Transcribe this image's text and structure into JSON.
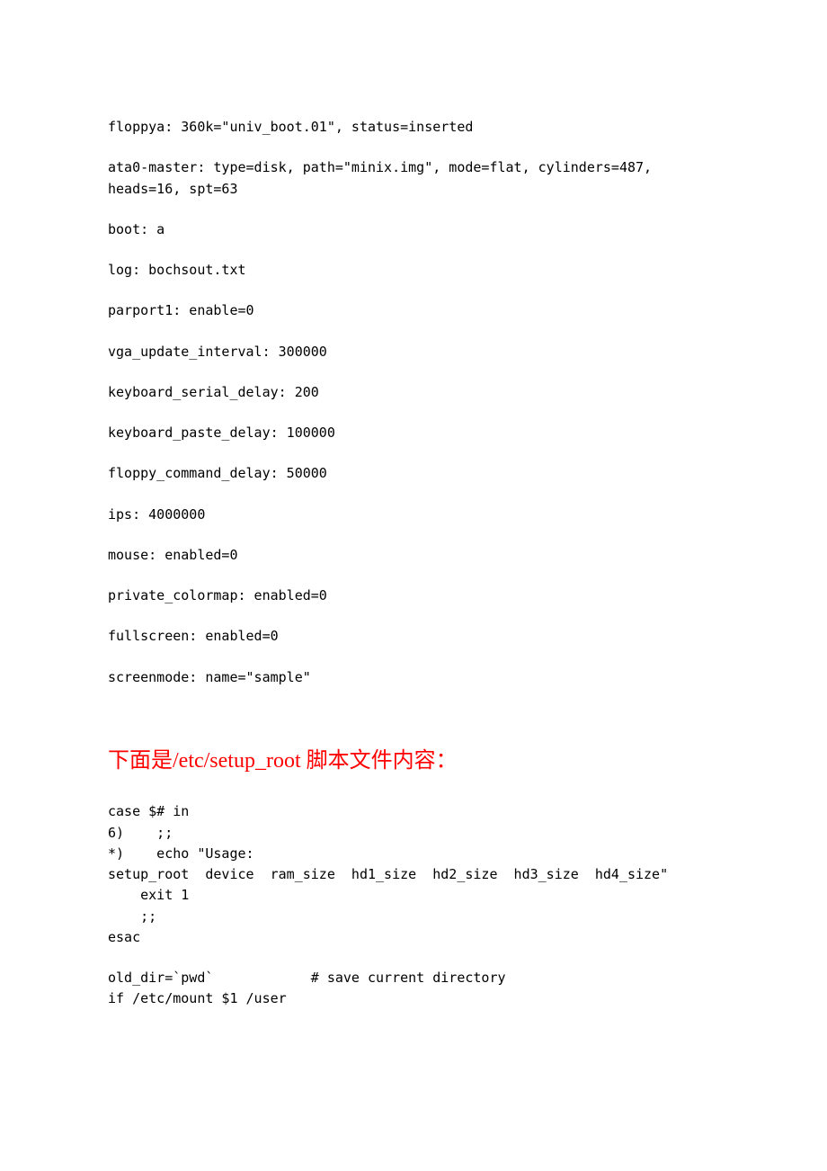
{
  "config_lines": [
    "floppya: 360k=\"univ_boot.01\", status=inserted",
    "ata0-master: type=disk, path=\"minix.img\", mode=flat, cylinders=487, heads=16, spt=63",
    "boot: a",
    "log: bochsout.txt",
    "parport1: enable=0",
    "vga_update_interval: 300000",
    "keyboard_serial_delay: 200",
    "keyboard_paste_delay: 100000",
    "floppy_command_delay: 50000",
    "ips: 4000000",
    "mouse: enabled=0",
    "private_colormap: enabled=0",
    "fullscreen: enabled=0",
    "screenmode: name=\"sample\""
  ],
  "heading": "下面是/etc/setup_root 脚本文件内容：",
  "script_block1": [
    "case $# in",
    "6)    ;;",
    "*)    echo \"Usage:",
    "setup_root  device  ram_size  hd1_size  hd2_size  hd3_size  hd4_size\"",
    "    exit 1",
    "    ;;",
    "esac"
  ],
  "script_block2": [
    "old_dir=`pwd`            # save current directory",
    "if /etc/mount $1 /user"
  ]
}
